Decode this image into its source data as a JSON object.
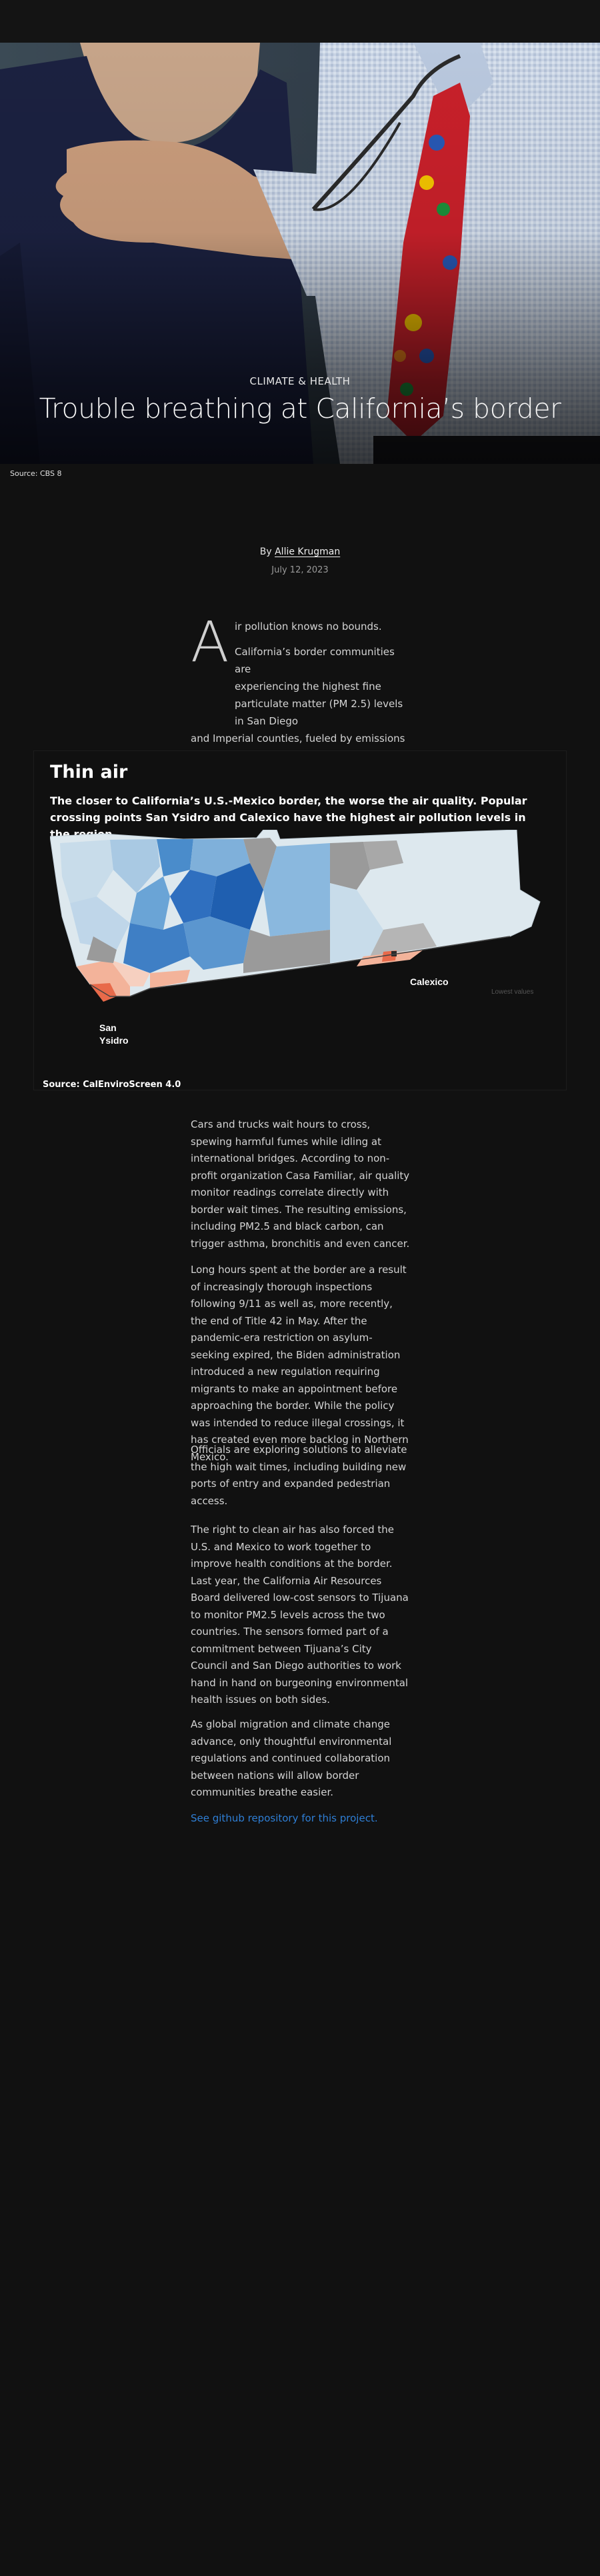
{
  "hero": {
    "kicker": "CLIMATE & HEALTH",
    "title": "Trouble breathing at California’s border",
    "image_source": "Source: CBS 8"
  },
  "byline": {
    "prefix": "By ",
    "author": "Allie Krugman",
    "date": "July 12, 2023"
  },
  "lede": {
    "dropcap": "A",
    "p1": "ir pollution knows no bounds.",
    "p2_lines": [
      "California’s border communities are",
      "experiencing the highest fine",
      "particulate matter (PM 2.5) levels in San Diego"
    ],
    "p2_rest": "and Imperial counties, fueled by emissions from the region’s busy entry points."
  },
  "map": {
    "title": "Thin air",
    "subtitle": "The closer to California’s U.S.-Mexico border, the worse the air quality. Popular crossing points San Ysidro and Calexico have the highest air pollution levels in the region.",
    "labels": {
      "san_ysidro_1": "San",
      "san_ysidro_2": "Ysidro",
      "calexico": "Calexico",
      "legend": "Lowest values"
    },
    "source": "Source: CalEnviroScreen 4.0",
    "colors": {
      "low": "#dde8ee",
      "mid": "#8ab8de",
      "high": "#1f5fb0",
      "hot": "#e86a4a",
      "warm": "#f3b39a",
      "nodata": "#a8a8a8"
    }
  },
  "body": {
    "p1": "Cars and trucks wait hours to cross, spewing harmful fumes while idling at international bridges. According to non-profit organization Casa Familiar, air quality monitor readings correlate directly with border wait times. The resulting emissions, including PM2.5 and black carbon, can trigger asthma, bronchitis and even cancer.",
    "p2": "Long hours spent at the border are a result of increasingly thorough inspections following 9/11 as well as, more recently, the end of Title 42 in May. After the pandemic-era restriction on asylum-seeking expired, the Biden administration introduced a new regulation requiring migrants to make an appointment before approaching the border. While the policy was intended to reduce illegal crossings, it has created even more backlog in Northern Mexico.",
    "p3": "Officials are exploring solutions to alleviate the high wait times, including building new ports of entry and expanded pedestrian access.",
    "p4": "The right to clean air has also forced the U.S. and Mexico to work together to improve health conditions at the border. Last year, the California Air Resources Board delivered low-cost sensors to Tijuana to monitor PM2.5 levels across the two countries. The sensors formed part of a commitment between Tijuana’s City Council and San Diego authorities to work hand in hand on burgeoning environmental health issues on both sides.",
    "p5": "As global migration and climate change advance, only thoughtful environmental regulations and continued collaboration between nations will allow border communities breathe easier.",
    "link": "See github repository for this project."
  }
}
